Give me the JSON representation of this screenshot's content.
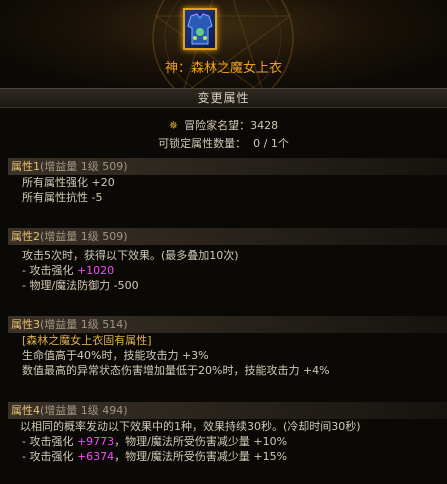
{
  "item": {
    "name": "神：森林之魔女上衣",
    "icon": "chest-armor-icon"
  },
  "section_title": "变更属性",
  "fame": {
    "label": "冒险家名望：",
    "value": "3428",
    "icon": "fame-icon"
  },
  "lock": {
    "label": "可锁定属性数量：",
    "value": "0 / 1个"
  },
  "attributes": [
    {
      "title": "属性1",
      "sub": "(增益量 1级 509)",
      "lines": [
        "所有属性强化 +20",
        "所有属性抗性 -5"
      ]
    },
    {
      "title": "属性2",
      "sub": "(增益量 1级 509)",
      "lines": [
        "攻击5次时，获得以下效果。(最多叠加10次)",
        "- 攻击强化 ",
        "+1020",
        "- 物理/魔法防御力 -500"
      ]
    },
    {
      "title": "属性3",
      "sub": "(增益量 1级 514)",
      "lines": [
        "[森林之魔女上衣固有属性]",
        "生命值高于40%时，技能攻击力 +3%",
        "数值最高的异常状态伤害增加量低于20%时，技能攻击力 +4%"
      ]
    },
    {
      "title": "属性4",
      "sub": "(增益量 1级 494)",
      "lines": [
        "以相同的概率发动以下效果中的1种，效果持续30秒。(冷却时间30秒)",
        "- 攻击强化 ",
        "+9773",
        "，物理/魔法所受伤害减少量 +10%",
        "- 攻击强化 ",
        "+6374",
        "，物理/魔法所受伤害减少量 +15%"
      ]
    }
  ]
}
